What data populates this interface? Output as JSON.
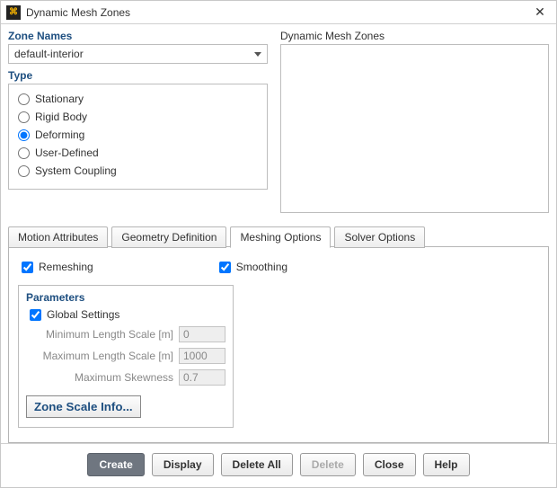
{
  "window": {
    "title": "Dynamic Mesh Zones"
  },
  "zone_names": {
    "label": "Zone Names",
    "selected": "default-interior"
  },
  "dmz": {
    "label": "Dynamic Mesh Zones"
  },
  "type": {
    "label": "Type",
    "options": [
      {
        "label": "Stationary",
        "checked": false
      },
      {
        "label": "Rigid Body",
        "checked": false
      },
      {
        "label": "Deforming",
        "checked": true
      },
      {
        "label": "User-Defined",
        "checked": false
      },
      {
        "label": "System Coupling",
        "checked": false
      }
    ]
  },
  "tabs": {
    "items": [
      {
        "label": "Motion Attributes"
      },
      {
        "label": "Geometry Definition"
      },
      {
        "label": "Meshing Options"
      },
      {
        "label": "Solver Options"
      }
    ],
    "active_index": 2
  },
  "meshing": {
    "remeshing": {
      "label": "Remeshing",
      "checked": true
    },
    "smoothing": {
      "label": "Smoothing",
      "checked": true
    },
    "parameters": {
      "title": "Parameters",
      "global_settings": {
        "label": "Global Settings",
        "checked": true
      },
      "min_length": {
        "label": "Minimum Length Scale [m]",
        "value": "0"
      },
      "max_length": {
        "label": "Maximum Length Scale [m]",
        "value": "1000"
      },
      "max_skewness": {
        "label": "Maximum Skewness",
        "value": "0.7"
      },
      "zone_scale_btn": "Zone Scale Info..."
    }
  },
  "footer": {
    "create": "Create",
    "display": "Display",
    "delete_all": "Delete All",
    "delete": "Delete",
    "close": "Close",
    "help": "Help"
  }
}
